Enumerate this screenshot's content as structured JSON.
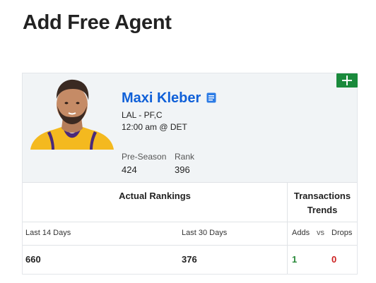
{
  "page": {
    "title": "Add Free Agent"
  },
  "player": {
    "name": "Maxi Kleber",
    "team_position": "LAL - PF,C",
    "game": "12:00 am @ DET",
    "stats": [
      {
        "label": "Pre-Season",
        "value": "424"
      },
      {
        "label": "Rank",
        "value": "396"
      }
    ]
  },
  "rankings": {
    "header": "Actual Rankings",
    "columns": [
      "Last 14 Days",
      "Last 30 Days"
    ],
    "values": [
      "660",
      "376"
    ]
  },
  "transactions": {
    "header_line1": "Transactions",
    "header_line2": "Trends",
    "adds_label": "Adds",
    "vs_label": "vs",
    "drops_label": "Drops",
    "adds_value": "1",
    "drops_value": "0"
  },
  "colors": {
    "accent_blue": "#1060d8",
    "add_green": "#1a8a3c",
    "adds": "#2a8a3a",
    "drops": "#cc1f1f"
  },
  "icons": [
    "plus-icon",
    "notes-icon",
    "player-photo"
  ]
}
